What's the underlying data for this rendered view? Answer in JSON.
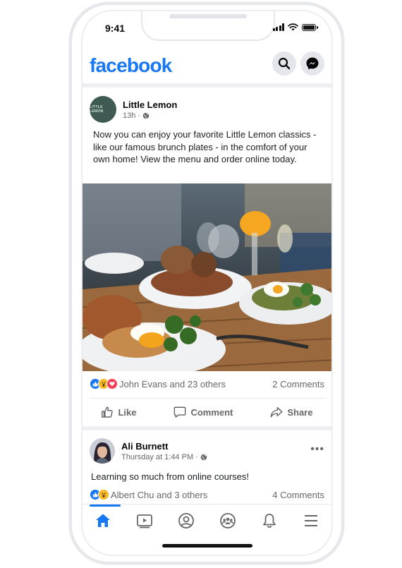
{
  "status_bar": {
    "time": "9:41"
  },
  "app": {
    "logo_text": "facebook",
    "brand_color": "#1877f2"
  },
  "header_icons": [
    "search-icon",
    "messenger-icon"
  ],
  "post1": {
    "author": "Little Lemon",
    "avatar_text": "LITTLE LEMON",
    "time": "13h",
    "privacy_icon": "globe-icon",
    "text": "Now you can enjoy your favorite Little Lemon classics - like our famous brunch plates - in the comfort of your own home! View the menu and order online today.",
    "reactions": [
      "like",
      "wow",
      "love"
    ],
    "reactions_text": "John Evans and 23 others",
    "comments_text": "2 Comments",
    "actions": {
      "like": "Like",
      "comment": "Comment",
      "share": "Share"
    }
  },
  "post2": {
    "author": "Ali Burnett",
    "time": "Thursday at 1:44 PM",
    "privacy_icon": "globe-icon",
    "more_label": "•••",
    "text": "Learning so much from online courses!",
    "reactions": [
      "like",
      "wow"
    ],
    "reactions_text": "Albert Chu and 3 others",
    "comments_text": "4 Comments"
  },
  "bottom_nav": {
    "active": "home",
    "items": [
      "home-icon",
      "watch-icon",
      "profile-icon",
      "groups-icon",
      "notifications-icon",
      "menu-icon"
    ]
  }
}
